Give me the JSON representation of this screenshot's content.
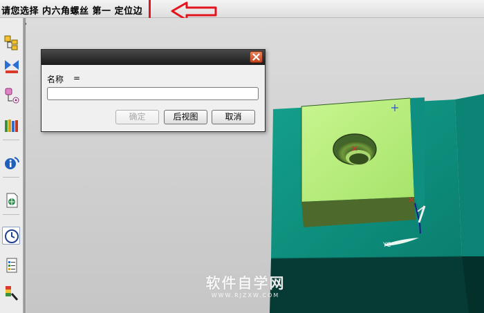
{
  "cue_line": {
    "text": "请您选择 内六角螺丝 第一 定位边"
  },
  "dialog": {
    "name_label": "名称",
    "name_equals": "=",
    "name_value": "",
    "buttons": {
      "ok": "确定",
      "back_view": "后视图",
      "cancel": "取消"
    }
  },
  "watermark": {
    "main": "软件自学网",
    "sub": "WWW.RJZXW.COM"
  },
  "colors": {
    "highlight": "#e3141d",
    "part_top": "#0f9a86",
    "block_top": "#b9f07d",
    "block_side": "#4f6b2e",
    "dialog_title": "#2a2a2a"
  },
  "resource_bar": {
    "items": [
      {
        "icon": "assembly-navigator-icon"
      },
      {
        "icon": "constraint-navigator-icon"
      },
      {
        "icon": "part-navigator-icon"
      },
      {
        "icon": "reuse-library-icon"
      },
      {
        "icon": "info-icon"
      },
      {
        "icon": "web-browser-icon"
      },
      {
        "icon": "history-clock-icon"
      },
      {
        "icon": "process-navigator-icon"
      },
      {
        "icon": "roles-icon"
      }
    ]
  }
}
